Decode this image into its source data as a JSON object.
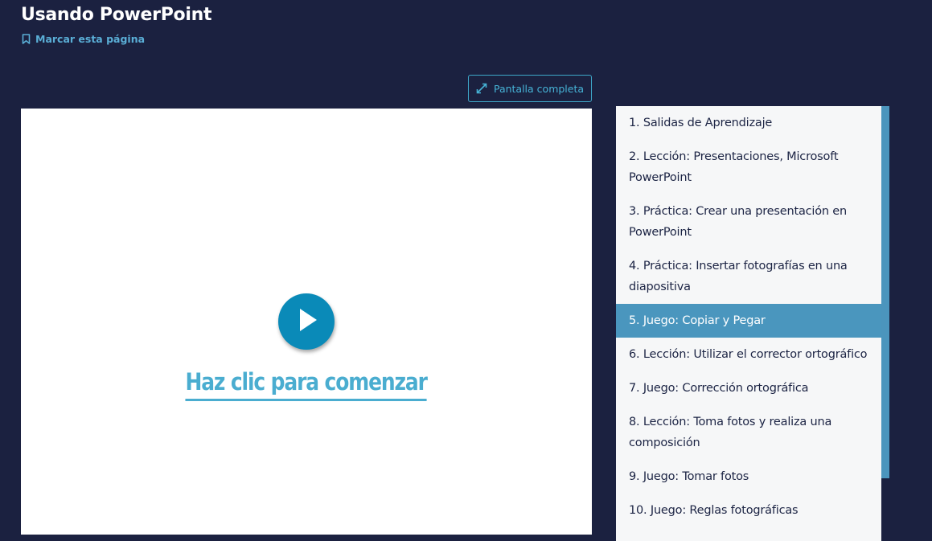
{
  "page": {
    "title": "Usando PowerPoint",
    "bookmark_label": "Marcar esta página"
  },
  "toolbar": {
    "fullscreen_label": "Pantalla completa"
  },
  "player": {
    "start_label": "Haz clic para comenzar"
  },
  "menu": {
    "items": [
      {
        "label": "1. Salidas de Aprendizaje",
        "active": false
      },
      {
        "label": "2. Lección: Presentaciones, Microsoft PowerPoint",
        "active": false
      },
      {
        "label": "3. Práctica: Crear una presentación en PowerPoint",
        "active": false
      },
      {
        "label": "4. Práctica: Insertar fotografías en una diapositiva",
        "active": false
      },
      {
        "label": "5. Juego: Copiar y Pegar",
        "active": true
      },
      {
        "label": "6. Lección: Utilizar el corrector ortográfico",
        "active": false
      },
      {
        "label": "7. Juego: Corrección ortográfica",
        "active": false
      },
      {
        "label": "8. Lección: Toma fotos y realiza una composición",
        "active": false
      },
      {
        "label": "9. Juego: Tomar fotos",
        "active": false
      },
      {
        "label": "10. Juego: Reglas fotográficas",
        "active": false
      }
    ]
  },
  "colors": {
    "background": "#1b2140",
    "accent": "#46b3d6",
    "active_item": "#4a96be",
    "play_button": "#0a8ab8"
  }
}
